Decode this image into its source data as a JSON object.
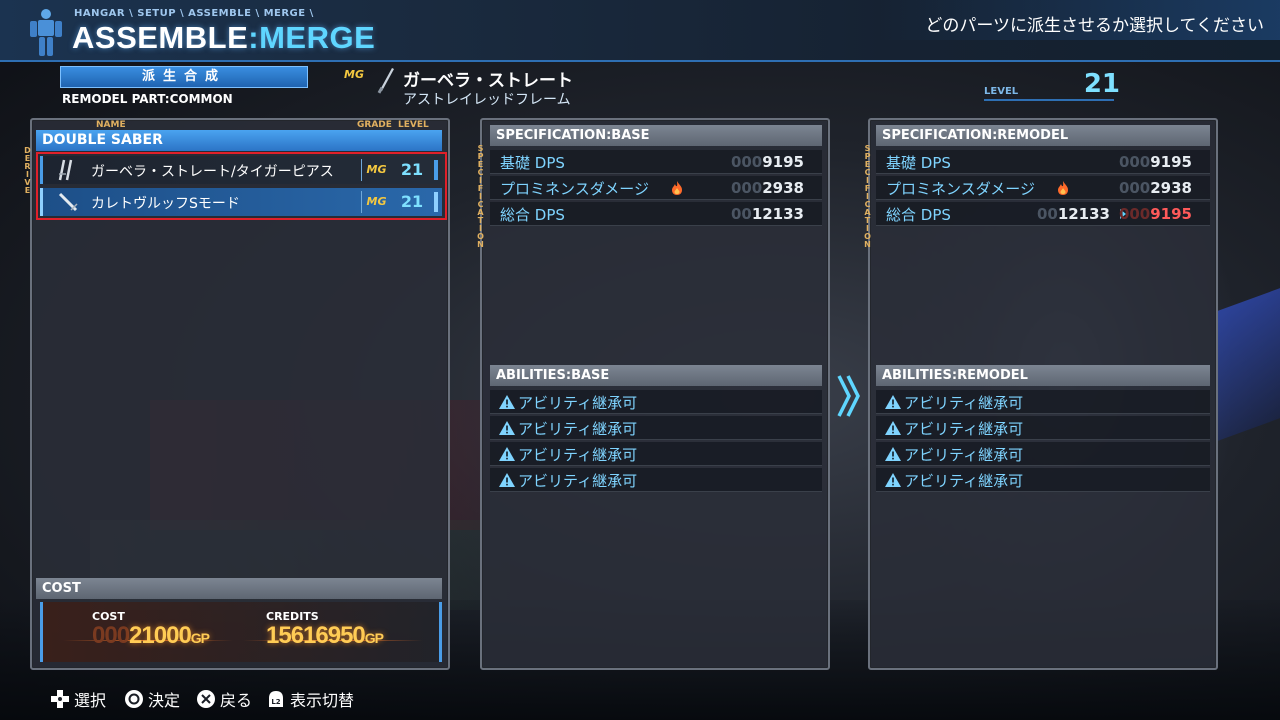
{
  "header": {
    "breadcrumb": "HANGAR \\ SETUP \\ ASSEMBLE \\ MERGE \\",
    "title_main": "ASSEMBLE",
    "title_sep": ":",
    "title_accent": "MERGE",
    "instruction": "どのパーツに派生させるか選択してください",
    "mode": "派生合成",
    "remodel_part": "REMODEL PART:COMMON"
  },
  "part": {
    "grade": "MG",
    "name": "ガーベラ・ストレート",
    "subtitle": "アストレイレッドフレーム",
    "level_label": "LEVEL",
    "level": "21"
  },
  "derive_list": {
    "title": "DOUBLE SABER",
    "side_label": "DERIVE",
    "columns": {
      "name": "NAME",
      "grade": "GRADE",
      "level": "LEVEL"
    },
    "items": [
      {
        "name": "ガーベラ・ストレート/タイガーピアス",
        "grade": "MG",
        "level": "21",
        "icon": "twin-blade-icon"
      },
      {
        "name": "カレトヴルッフSモード",
        "grade": "MG",
        "level": "21",
        "icon": "saber-icon"
      }
    ]
  },
  "cost": {
    "title": "COST",
    "cost_label": "COST",
    "cost_pad": "000",
    "cost_value": "21000",
    "credits_label": "CREDITS",
    "credits_value": "15616950",
    "unit": "GP"
  },
  "spec_base": {
    "title": "SPECIFICATION:BASE",
    "side_label": "SPECIFICATION",
    "rows": [
      {
        "label": "基礎 DPS",
        "pad": "000",
        "value": "9195"
      },
      {
        "label": "プロミネンスダメージ",
        "pad": "000",
        "value": "2938",
        "icon": "fire-icon"
      },
      {
        "label": "総合 DPS",
        "pad": "00",
        "value": "12133"
      }
    ]
  },
  "spec_remodel": {
    "title": "SPECIFICATION:REMODEL",
    "side_label": "SPECIFICATION",
    "rows": [
      {
        "label": "基礎 DPS",
        "pad": "000",
        "value": "9195"
      },
      {
        "label": "プロミネンスダメージ",
        "pad": "000",
        "value": "2938",
        "icon": "fire-icon"
      },
      {
        "label": "総合 DPS",
        "pad": "00",
        "value": "12133",
        "new_pad": "000",
        "new_value": "9195"
      }
    ]
  },
  "abilities_base": {
    "title": "ABILITIES:BASE",
    "items": [
      "アビリティ継承可",
      "アビリティ継承可",
      "アビリティ継承可",
      "アビリティ継承可"
    ]
  },
  "abilities_remodel": {
    "title": "ABILITIES:REMODEL",
    "items": [
      "アビリティ継承可",
      "アビリティ継承可",
      "アビリティ継承可",
      "アビリティ継承可"
    ]
  },
  "footer": {
    "select": "選択",
    "confirm": "決定",
    "back": "戻る",
    "toggle": "表示切替",
    "toggle_key": "L2"
  },
  "colors": {
    "accent": "#5fd6ff",
    "stat_label": "#7fd4ff",
    "gold": "#ffcc55",
    "grade": "#f4c840",
    "decrease": "#ff5a5a",
    "highlight_frame": "#e0202a"
  }
}
